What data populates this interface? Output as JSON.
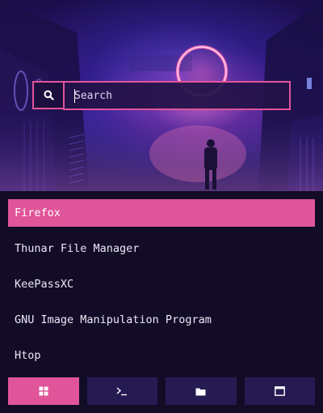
{
  "search": {
    "placeholder": "Search",
    "value": ""
  },
  "apps": [
    {
      "label": "Firefox",
      "selected": true
    },
    {
      "label": "Thunar File Manager",
      "selected": false
    },
    {
      "label": "KeePassXC",
      "selected": false
    },
    {
      "label": "GNU Image Manipulation Program",
      "selected": false
    },
    {
      "label": "Htop",
      "selected": false
    }
  ],
  "modes": [
    {
      "icon": "grid-icon",
      "active": true
    },
    {
      "icon": "terminal-icon",
      "active": false
    },
    {
      "icon": "folder-icon",
      "active": false
    },
    {
      "icon": "window-icon",
      "active": false
    }
  ],
  "colors": {
    "accent": "#e0559a",
    "background": "#130c27",
    "button": "#261a52",
    "text": "#ece8f6"
  }
}
